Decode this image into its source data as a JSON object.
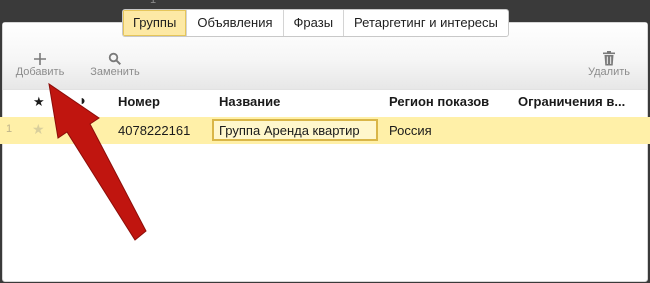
{
  "top_number": "1",
  "tabs": [
    {
      "label": "Группы",
      "active": true
    },
    {
      "label": "Объявления",
      "active": false
    },
    {
      "label": "Фразы",
      "active": false
    },
    {
      "label": "Ретаргетинг и интересы",
      "active": false
    }
  ],
  "toolbar": {
    "add_label": "Добавить",
    "replace_label": "Заменить",
    "delete_label": "Удалить",
    "icons": {
      "add": "plus-icon",
      "replace": "search-icon",
      "delete": "trash-icon"
    }
  },
  "table": {
    "headers": {
      "star": "★",
      "flag": "◗",
      "number": "Номер",
      "name": "Название",
      "region": "Регион показов",
      "limits": "Ограничения в..."
    },
    "rows": [
      {
        "index": "1",
        "starred": false,
        "star": "★",
        "number": "4078222161",
        "name": "Группа Аренда квартир",
        "region": "Россия"
      }
    ]
  },
  "colors": {
    "active_tab": "#fde9a5",
    "selected_row": "#fff0a8",
    "arrow": "#c0150f"
  }
}
